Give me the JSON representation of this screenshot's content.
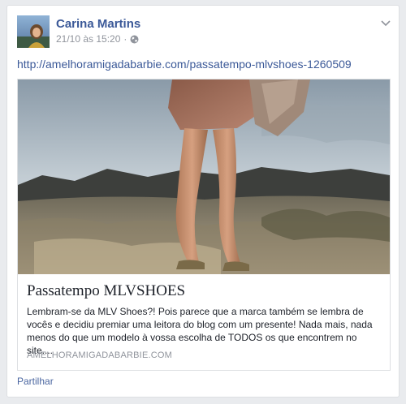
{
  "post": {
    "author": "Carina Martins",
    "timestamp": "21/10 às 15:20",
    "separator": "·",
    "privacy_icon": "globe-icon",
    "menu_icon": "chevron-down-icon",
    "link_text": "http://amelhoramigadabarbie.com/passatempo-mlvshoes-1260509"
  },
  "link_card": {
    "title": "Passatempo MLVSHOES",
    "description": "Lembram-se da MLV Shoes?! Pois parece que a marca também se lembra de vocês e decidiu premiar uma leitora do blog com um presente! Nada mais, nada menos do que um modelo à vossa escolha de TODOS os que encontrem no site....",
    "domain": "AMELHORAMIGADABARBIE.COM"
  },
  "actions": {
    "share_label": "Partilhar"
  },
  "colors": {
    "link_blue": "#3b5998",
    "muted_gray": "#90949c",
    "page_background": "#e9ebee"
  }
}
